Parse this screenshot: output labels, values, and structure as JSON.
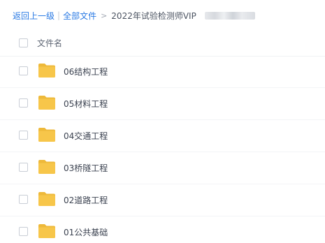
{
  "breadcrumb": {
    "back_label": "返回上一级",
    "all_files_label": "全部文件",
    "current_label": "2022年试验检测师VIP"
  },
  "list_header": {
    "name_column": "文件名"
  },
  "files": [
    {
      "name": "06结构工程",
      "icon": "folder-icon"
    },
    {
      "name": "05材料工程",
      "icon": "folder-icon"
    },
    {
      "name": "04交通工程",
      "icon": "folder-icon"
    },
    {
      "name": "03桥隧工程",
      "icon": "folder-icon"
    },
    {
      "name": "02道路工程",
      "icon": "folder-icon"
    },
    {
      "name": "01公共基础",
      "icon": "folder-icon"
    }
  ],
  "colors": {
    "link": "#2a7ae4",
    "folder": "#f7c64a",
    "folder_tab": "#eeb93a"
  }
}
